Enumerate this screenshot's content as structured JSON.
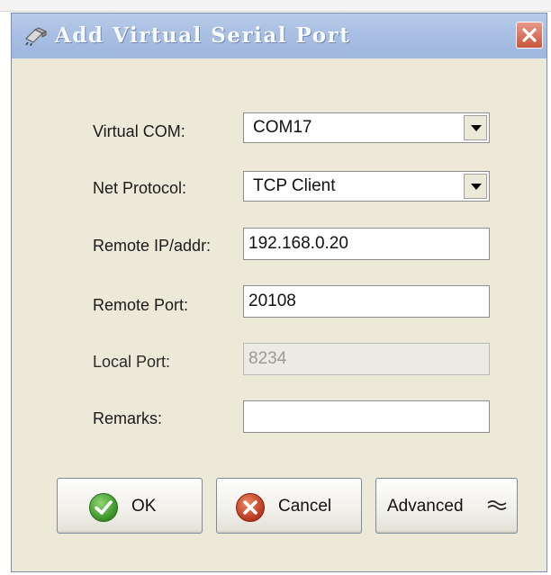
{
  "window": {
    "title": "Add Virtual Serial Port"
  },
  "form": {
    "virtual_com": {
      "label": "Virtual COM:",
      "value": "COM17"
    },
    "net_protocol": {
      "label": "Net Protocol:",
      "value": "TCP Client"
    },
    "remote_ip": {
      "label": "Remote IP/addr:",
      "value": "192.168.0.20"
    },
    "remote_port": {
      "label": "Remote Port:",
      "value": "20108"
    },
    "local_port": {
      "label": "Local Port:",
      "value": "8234"
    },
    "remarks": {
      "label": "Remarks:",
      "value": ""
    }
  },
  "buttons": {
    "ok": "OK",
    "cancel": "Cancel",
    "advanced": "Advanced"
  },
  "colors": {
    "dialog_bg": "#ece9d8",
    "titlebar": "#a9bfe3",
    "close_button": "#c9543b",
    "ok_icon_green": "#3e9a2a",
    "cancel_icon_red": "#c23a1e"
  },
  "icons": {
    "title": "network-plug-icon",
    "close": "close-icon",
    "ok": "checkmark-circle-icon",
    "cancel": "x-circle-icon",
    "advanced": "double-chevron-icon"
  }
}
